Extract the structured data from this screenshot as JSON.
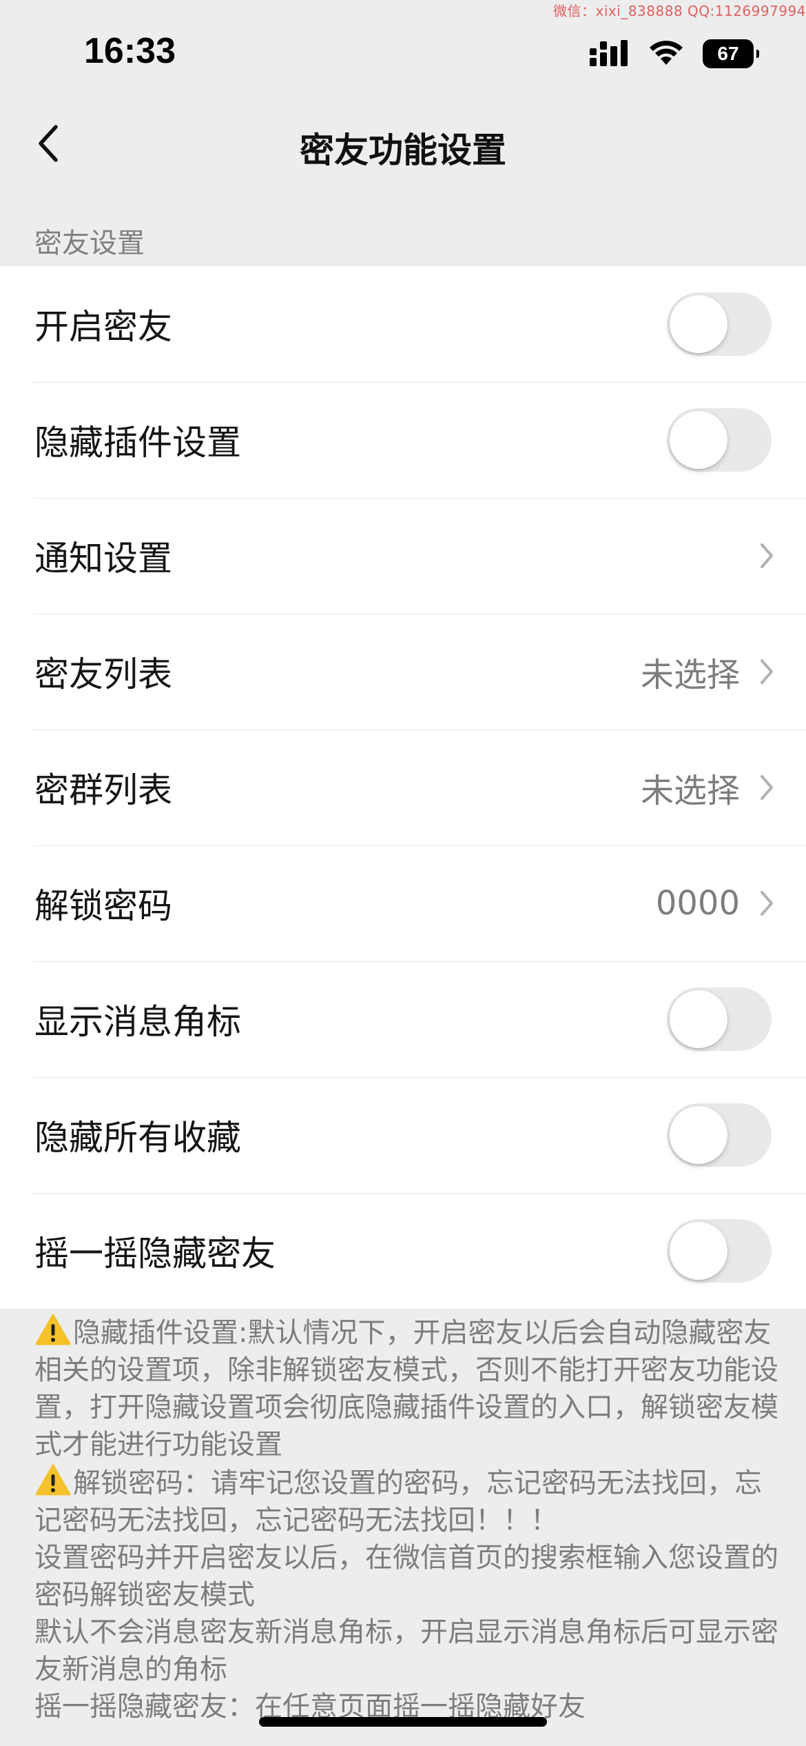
{
  "watermark": "微信：xixi_838888    QQ:1126997994",
  "status": {
    "time": "16:33",
    "battery": "67",
    "icons": [
      "cellular-signal-icon",
      "wifi-icon",
      "battery-icon"
    ]
  },
  "nav": {
    "back_icon": "chevron-left-icon",
    "title": "密友功能设置"
  },
  "section": {
    "header": "密友设置"
  },
  "rows": [
    {
      "label": "开启密友",
      "type": "toggle",
      "on": false
    },
    {
      "label": "隐藏插件设置",
      "type": "toggle",
      "on": false
    },
    {
      "label": "通知设置",
      "type": "link",
      "value": ""
    },
    {
      "label": "密友列表",
      "type": "link",
      "value": "未选择"
    },
    {
      "label": "密群列表",
      "type": "link",
      "value": "未选择"
    },
    {
      "label": "解锁密码",
      "type": "link",
      "value": "0000"
    },
    {
      "label": "显示消息角标",
      "type": "toggle",
      "on": false
    },
    {
      "label": "隐藏所有收藏",
      "type": "toggle",
      "on": false
    },
    {
      "label": "摇一摇隐藏密友",
      "type": "toggle",
      "on": false
    }
  ],
  "colors": {
    "page_bg": "#ededed",
    "card_bg": "#ffffff",
    "toggle_off": "#e9e9ea",
    "secondary_text": "#7d7d7d"
  },
  "notes": {
    "warning_icon": "warning-icon",
    "p1": "隐藏插件设置:默认情况下，开启密友以后会自动隐藏密友相关的设置项，除非解锁密友模式，否则不能打开密友功能设置，打开隐藏设置项会彻底隐藏插件设置的入口，解锁密友模式才能进行功能设置",
    "p2": "解锁密码：请牢记您设置的密码，忘记密码无法找回，忘记密码无法找回，忘记密码无法找回！！！",
    "p3": "设置密码并开启密友以后，在微信首页的搜索框输入您设置的密码解锁密友模式",
    "p4": "默认不会消息密友新消息角标，开启显示消息角标后可显示密友新消息的角标",
    "p5": "摇一摇隐藏密友：在任意页面摇一摇隐藏好友"
  }
}
